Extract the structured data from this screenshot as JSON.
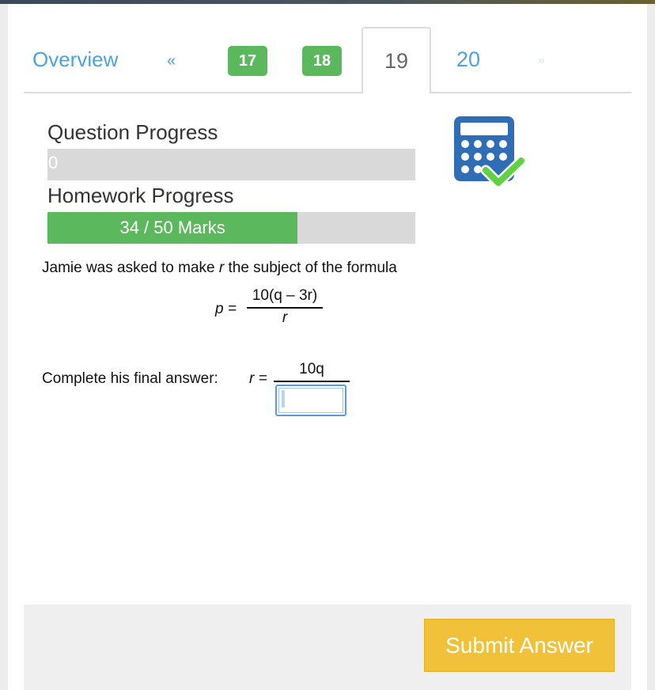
{
  "tabs": {
    "overview": "Overview",
    "prev": "«",
    "completed": [
      "17",
      "18"
    ],
    "current": "19",
    "next_number": "20",
    "next": "»"
  },
  "progress": {
    "question_label": "Question Progress",
    "question_value": "0",
    "question_fraction": 0,
    "homework_label": "Homework Progress",
    "homework_value": "34 / 50 Marks",
    "homework_fraction": 0.68
  },
  "icons": {
    "calculator": "calculator-check-icon",
    "calculator_color": "#2f6db5",
    "check_color": "#5fd142"
  },
  "question": {
    "intro_prefix": "Jamie was asked to make ",
    "intro_var": "r",
    "intro_suffix": " the subject of the formula",
    "formula_lhs": "p =",
    "formula_numerator": "10(q – 3r)",
    "formula_denominator": "r",
    "answer_prompt": "Complete his final answer:",
    "answer_lhs": "r =",
    "answer_numerator": "10q",
    "answer_value": ""
  },
  "footer": {
    "submit_label": "Submit Answer"
  },
  "colors": {
    "link": "#4aa3df",
    "success": "#5cb85c",
    "submit": "#f0c139"
  }
}
